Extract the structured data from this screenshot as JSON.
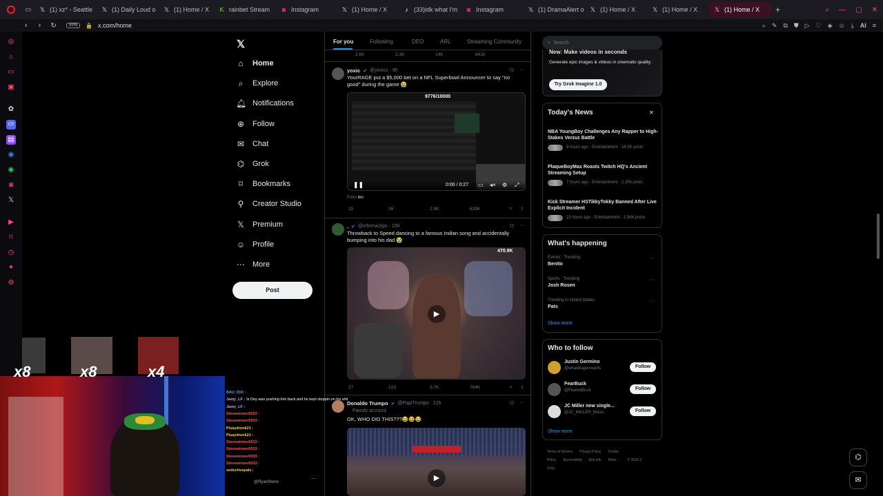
{
  "browser": {
    "tabs": [
      {
        "icon": "x-logo-icon",
        "label": "(1) xz* - Seattle"
      },
      {
        "icon": "x-logo-icon",
        "label": "(1) Daily Loud o"
      },
      {
        "icon": "x-logo-icon",
        "label": "(1) Home / X"
      },
      {
        "icon": "kick-icon",
        "label": "rainbet Stream"
      },
      {
        "icon": "instagram-icon",
        "label": "Instagram"
      },
      {
        "icon": "x-logo-icon",
        "label": "(1) Home / X"
      },
      {
        "icon": "tiktok-icon",
        "label": "(33)idk what I'm"
      },
      {
        "icon": "instagram-icon",
        "label": "Instagram"
      },
      {
        "icon": "x-logo-icon",
        "label": "(1) DramaAlert o"
      },
      {
        "icon": "x-logo-icon",
        "label": "(1) Home / X"
      },
      {
        "icon": "x-logo-icon",
        "label": "(1) Home / X"
      },
      {
        "icon": "x-logo-icon",
        "label": "(1) Home / X"
      }
    ],
    "vpn_label": "VPN",
    "url": "x.com/home",
    "ai_label": "AI"
  },
  "nav": {
    "items": [
      {
        "icon": "home-icon",
        "label": "Home"
      },
      {
        "icon": "search-icon",
        "label": "Explore"
      },
      {
        "icon": "bell-icon",
        "label": "Notifications"
      },
      {
        "icon": "follow-icon",
        "label": "Follow"
      },
      {
        "icon": "chat-icon",
        "label": "Chat"
      },
      {
        "icon": "grok-icon",
        "label": "Grok"
      },
      {
        "icon": "bookmark-icon",
        "label": "Bookmarks"
      },
      {
        "icon": "creator-studio-icon",
        "label": "Creator Studio"
      },
      {
        "icon": "x-premium-icon",
        "label": "Premium"
      },
      {
        "icon": "profile-icon",
        "label": "Profile"
      },
      {
        "icon": "more-icon",
        "label": "More"
      }
    ],
    "post_label": "Post"
  },
  "feed": {
    "tabs": [
      "For you",
      "Following",
      "DEO",
      "ARL",
      "Streaming Community"
    ],
    "top_actions": [
      "2.6K",
      "2.3K",
      "14K",
      "841K"
    ],
    "tweets": [
      {
        "name": "yoxic",
        "handle": "@yoxics · 9h",
        "text": "YourRAGE put a $5,000 bet on a NFL Superbowl Announcer to say \"no good\" during the game 😭",
        "video_counter": "9776/10000",
        "video_time": "0:00 / 0:27",
        "from_label": "From",
        "from_user": "leo",
        "actions": [
          "15",
          "26",
          "2.9K",
          "639K"
        ]
      },
      {
        "name": ".",
        "handle": "@infernaclips · 10h",
        "text": "Throwback to Speed dancing to a famous Indian song and accidentally bumping into his dad 😭",
        "video_badge": "470.9K",
        "actions": [
          "27",
          "123",
          "3.7K",
          "764K"
        ]
      },
      {
        "name": "Donaldo Trumpo",
        "handle": "@PapiTrumpo · 12h",
        "parody": "Parody account",
        "text": "OK, WHO DID THIS???😂😂😂"
      }
    ]
  },
  "right": {
    "search_placeholder": "Search",
    "promo": {
      "title": "New: Make videos in seconds",
      "text": "Generate epic images & videos in cinematic quality.",
      "button": "Try Grok Imagine 1.0"
    },
    "news": {
      "title": "Today's News",
      "items": [
        {
          "title": "NBA YoungBoy Challenges Any Rapper to High-Stakes Verzuz Battle",
          "meta": "9 hours ago · Entertainment · 18.2K posts"
        },
        {
          "title": "PlaqueBoyMax Roasts Twitch HQ's Ancient Streaming Setup",
          "meta": "7 hours ago · Entertainment · 2,206 posts"
        },
        {
          "title": "Kick Streamer HSTikkyTokky Banned After Live Explicit Incident",
          "meta": "22 hours ago · Entertainment · 1,946 posts"
        }
      ]
    },
    "happening": {
      "title": "What's happening",
      "items": [
        {
          "context": "Events · Trending",
          "topic": "Benito"
        },
        {
          "context": "Sports · Trending",
          "topic": "Josh Rosen"
        },
        {
          "context": "Trending in United States",
          "topic": "Pats"
        }
      ],
      "show_more": "Show more"
    },
    "who_to_follow": {
      "title": "Who to follow",
      "items": [
        {
          "name": "Justin Germino",
          "handle": "@whatdragonwants",
          "button": "Follow"
        },
        {
          "name": "FearBuck",
          "handle": "@FearedBuck",
          "button": "Follow"
        },
        {
          "name": "JC Miller new single...",
          "handle": "@JC_MILLER_Music",
          "button": "Follow"
        }
      ],
      "show_more": "Show more"
    },
    "footer": [
      "Terms of Service",
      "Privacy Policy",
      "Cookie Policy",
      "Accessibility",
      "Ads info",
      "More ···",
      "© 2026 X Corp."
    ]
  },
  "overlay": {
    "multipliers": [
      "x8",
      "x8",
      "x4"
    ],
    "chat": [
      {
        "user": "BAU_IOO :",
        "msg": "",
        "color": "#5aa0ff"
      },
      {
        "user": "Jamy_LF :",
        "msg": "Is Dey was pushing him back and he kept steppin on his shit",
        "color": "#c9a0ff"
      },
      {
        "user": "Jamy_LF :",
        "msg": "",
        "color": "#c9a0ff"
      },
      {
        "user": "Stevewinner6533 :",
        "msg": "",
        "color": "#ff5555"
      },
      {
        "user": "Stevewinner6533 :",
        "msg": "",
        "color": "#ff5555"
      },
      {
        "user": "Pisaydrunk21 :",
        "msg": "",
        "color": "#ffd23f"
      },
      {
        "user": "Pisaydrunk21 :",
        "msg": "",
        "color": "#ffd23f"
      },
      {
        "user": "Stevewinner6533 :",
        "msg": "",
        "color": "#ff5555"
      },
      {
        "user": "Stevewinner6533 :",
        "msg": "",
        "color": "#ff5555"
      },
      {
        "user": "Stevewinner6533 :",
        "msg": "",
        "color": "#ff5555"
      },
      {
        "user": "Stevewinner6533 :",
        "msg": "",
        "color": "#ff5555"
      },
      {
        "user": "seductivepals :",
        "msg": "",
        "color": "#ffd23f"
      }
    ],
    "account_label": "@RyanStone"
  }
}
